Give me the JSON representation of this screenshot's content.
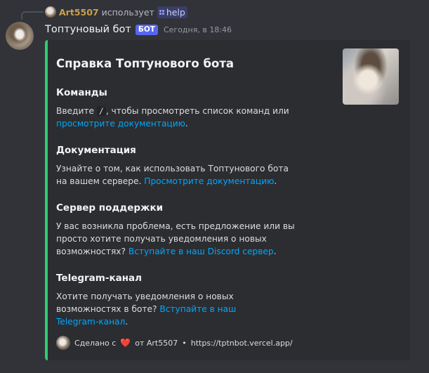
{
  "reply": {
    "user": "Art5507",
    "verb": "использует",
    "command": "help"
  },
  "message": {
    "author": "Топтуновый бот",
    "bot_tag": "БОТ",
    "timestamp": "Сегодня, в 18:46"
  },
  "embed": {
    "accent_color": "#2ecc71",
    "title": "Справка Топтунового бота",
    "fields": [
      {
        "name": "Команды",
        "text_before": "Введите",
        "code": "/",
        "text_middle": ", чтобы просмотреть список команд или",
        "link": "просмотрите документацию",
        "text_after": "."
      },
      {
        "name": "Документация",
        "text_before": "Узнайте о том, как использовать Топтунового бота на вашем сервере.",
        "link": "Просмотрите документацию",
        "text_after": "."
      },
      {
        "name": "Сервер поддержки",
        "text_before": "У вас возникла проблема, есть предложение или вы просто хотите получать уведомления о новых возможностях?",
        "link": "Вступайте в наш Discord сервер",
        "text_after": "."
      },
      {
        "name": "Telegram-канал",
        "text_before": "Хотите получать уведомления о новых возможностях в боте?",
        "link": "Вступайте в наш Telegram-канал",
        "text_after": "."
      }
    ],
    "footer": {
      "made_with": "Сделано с",
      "heart": "❤️",
      "by": "от Art5507",
      "separator": "•",
      "url": "https://tptnbot.vercel.app/"
    }
  },
  "icons": {
    "command": "slash-command-icon",
    "heart": "heart-icon"
  }
}
